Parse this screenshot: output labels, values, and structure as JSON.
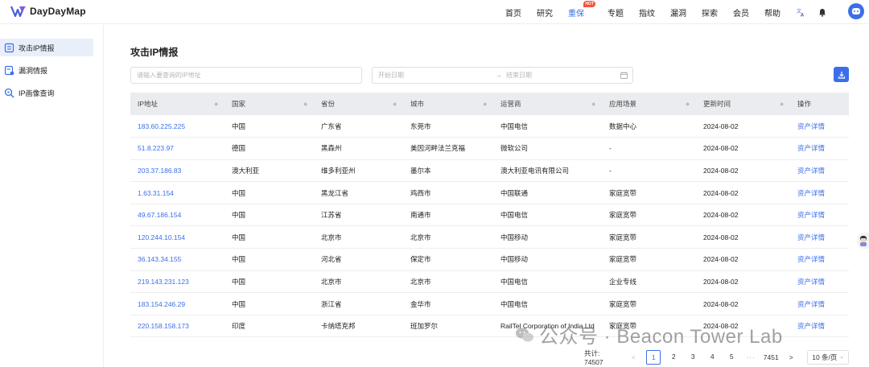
{
  "brand": {
    "name": "DayDayMap"
  },
  "nav": {
    "items": [
      {
        "label": "首页",
        "active": false
      },
      {
        "label": "研究",
        "active": false
      },
      {
        "label": "重保",
        "active": true,
        "badge": "HOT"
      },
      {
        "label": "专题",
        "active": false
      },
      {
        "label": "指纹",
        "active": false
      },
      {
        "label": "漏洞",
        "active": false
      },
      {
        "label": "探索",
        "active": false
      },
      {
        "label": "会员",
        "active": false
      },
      {
        "label": "帮助",
        "active": false
      }
    ],
    "icons": [
      "translate-icon",
      "bell-icon",
      "user-avatar-icon"
    ]
  },
  "sidebar": {
    "items": [
      {
        "label": "攻击IP情报",
        "icon": "report-icon",
        "active": true
      },
      {
        "label": "漏洞情报",
        "icon": "vuln-report-icon",
        "active": false
      },
      {
        "label": "IP画像查询",
        "icon": "ip-search-icon",
        "active": false
      }
    ]
  },
  "page": {
    "title": "攻击IP情报"
  },
  "filters": {
    "search_placeholder": "请输入要查询的IP地址",
    "date_start_placeholder": "开始日期",
    "date_separator": "→",
    "date_end_placeholder": "结束日期"
  },
  "table": {
    "columns": [
      "IP地址",
      "国家",
      "省份",
      "城市",
      "运营商",
      "应用场景",
      "更新时间",
      "操作"
    ],
    "rows": [
      {
        "ip": "183.60.225.225",
        "country": "中国",
        "province": "广东省",
        "city": "东莞市",
        "isp": "中国电信",
        "scene": "数据中心",
        "updated": "2024-08-02",
        "action": "资产详情"
      },
      {
        "ip": "51.8.223.97",
        "country": "德国",
        "province": "黑森州",
        "city": "美因河畔法兰克福",
        "isp": "微软公司",
        "scene": "-",
        "updated": "2024-08-02",
        "action": "资产详情"
      },
      {
        "ip": "203.37.186.83",
        "country": "澳大利亚",
        "province": "维多利亚州",
        "city": "墨尔本",
        "isp": "澳大利亚电讯有限公司",
        "scene": "-",
        "updated": "2024-08-02",
        "action": "资产详情"
      },
      {
        "ip": "1.63.31.154",
        "country": "中国",
        "province": "黑龙江省",
        "city": "鸡西市",
        "isp": "中国联通",
        "scene": "家庭宽带",
        "updated": "2024-08-02",
        "action": "资产详情"
      },
      {
        "ip": "49.67.186.154",
        "country": "中国",
        "province": "江苏省",
        "city": "南通市",
        "isp": "中国电信",
        "scene": "家庭宽带",
        "updated": "2024-08-02",
        "action": "资产详情"
      },
      {
        "ip": "120.244.10.154",
        "country": "中国",
        "province": "北京市",
        "city": "北京市",
        "isp": "中国移动",
        "scene": "家庭宽带",
        "updated": "2024-08-02",
        "action": "资产详情"
      },
      {
        "ip": "36.143.34.155",
        "country": "中国",
        "province": "河北省",
        "city": "保定市",
        "isp": "中国移动",
        "scene": "家庭宽带",
        "updated": "2024-08-02",
        "action": "资产详情"
      },
      {
        "ip": "219.143.231.123",
        "country": "中国",
        "province": "北京市",
        "city": "北京市",
        "isp": "中国电信",
        "scene": "企业专线",
        "updated": "2024-08-02",
        "action": "资产详情"
      },
      {
        "ip": "183.154.246.29",
        "country": "中国",
        "province": "浙江省",
        "city": "金华市",
        "isp": "中国电信",
        "scene": "家庭宽带",
        "updated": "2024-08-02",
        "action": "资产详情"
      },
      {
        "ip": "220.158.158.173",
        "country": "印度",
        "province": "卡纳塔克邦",
        "city": "班加罗尔",
        "isp": "RailTel Corporation of India Ltd",
        "scene": "家庭宽带",
        "updated": "2024-08-02",
        "action": "资产详情"
      }
    ]
  },
  "pagination": {
    "total_label": "共计: 74507",
    "pages": [
      "1",
      "2",
      "3",
      "4",
      "5"
    ],
    "current_page": "1",
    "ellipsis": "···",
    "last_page": "7451",
    "page_size": "10 条/页"
  },
  "watermark": {
    "text": "公众号 · Beacon Tower Lab"
  },
  "colors": {
    "accent": "#3b6fe9",
    "header_bg": "#ebecef",
    "hot_badge": "#f5533d"
  }
}
